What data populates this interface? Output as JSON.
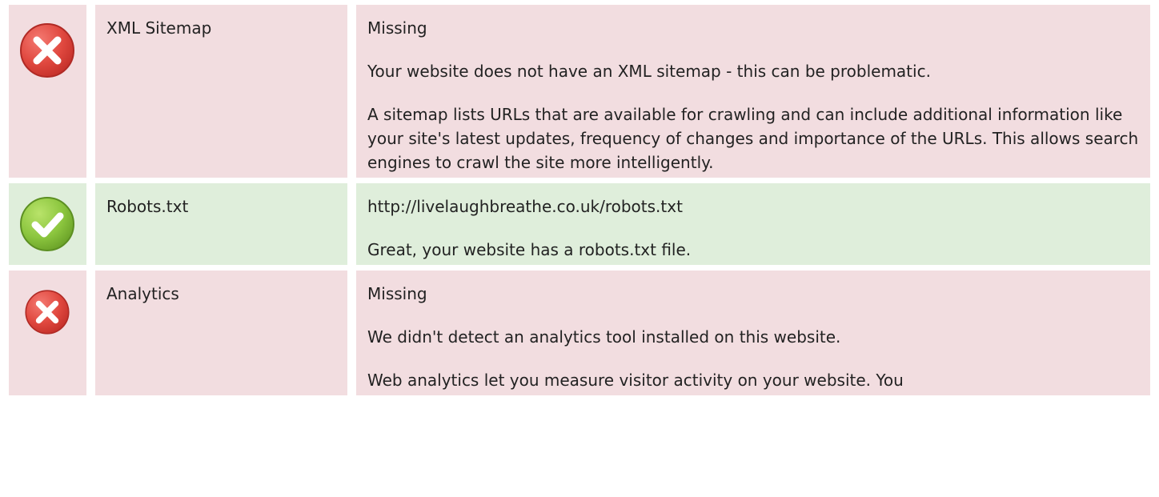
{
  "checks": [
    {
      "status": "fail",
      "icon": "error-x-icon",
      "label": "XML Sitemap",
      "details": [
        "Missing",
        "Your website does not have an XML sitemap - this can be problematic.",
        "A sitemap lists URLs that are available for crawling and can include additional information like your site's latest updates, frequency of changes and importance of the URLs. This allows search engines to crawl the site more intelligently."
      ]
    },
    {
      "status": "pass",
      "icon": "success-check-icon",
      "label": "Robots.txt",
      "details": [
        "http://livelaughbreathe.co.uk/robots.txt",
        "Great, your website has a robots.txt file."
      ]
    },
    {
      "status": "fail",
      "icon": "error-x-icon",
      "label": "Analytics",
      "details": [
        "Missing",
        "We didn't detect an analytics tool installed on this website.",
        "Web analytics let you measure visitor activity on your website. You"
      ]
    }
  ],
  "colors": {
    "fail_row": "#f2dde0",
    "pass_row": "#dfeedb",
    "fail_icon": "#e0483f",
    "pass_icon": "#8cc63f"
  }
}
